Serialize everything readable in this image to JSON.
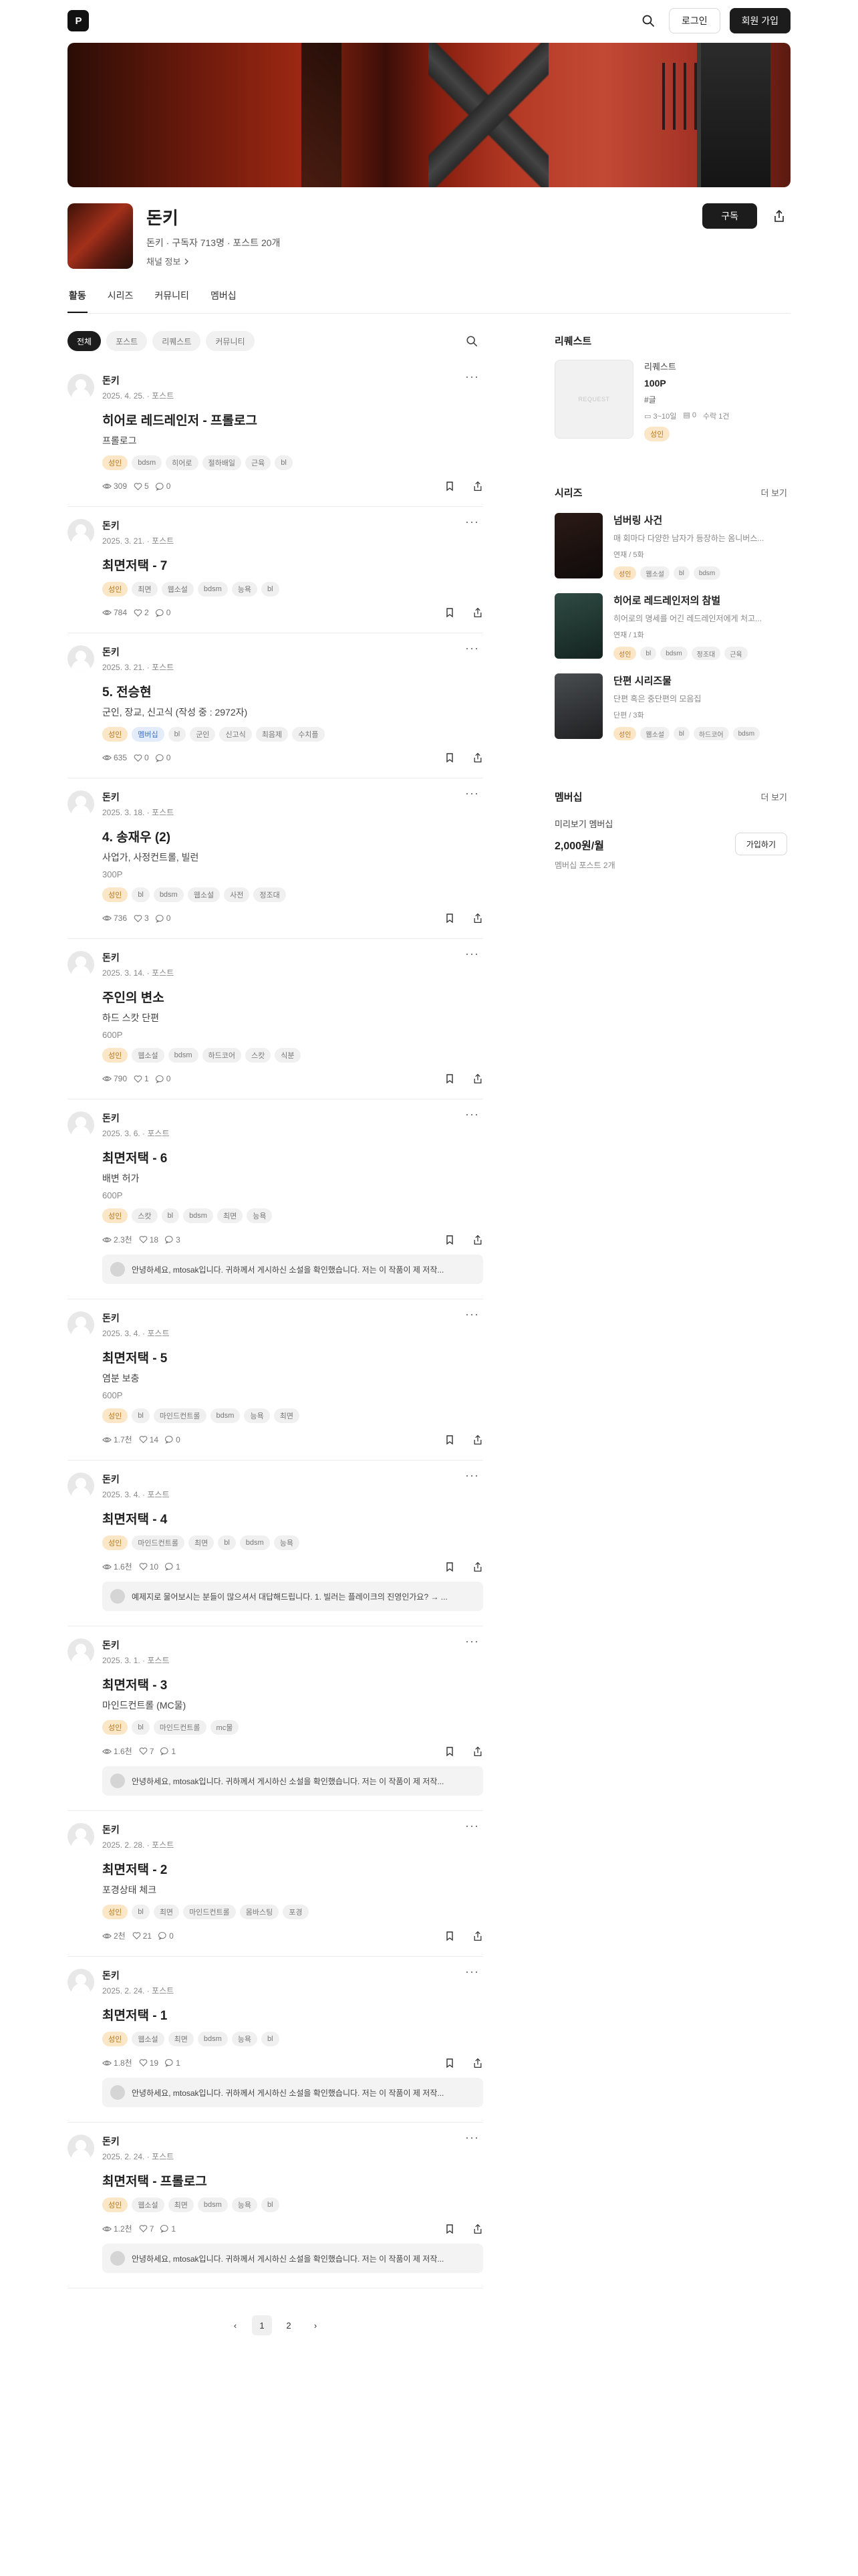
{
  "header": {
    "logo_text": "P",
    "login_label": "로그인",
    "signup_label": "회원 가입"
  },
  "profile": {
    "name": "돈키",
    "meta": "돈키 · 구독자 713명 · 포스트 20개",
    "channel_info": "채널 정보",
    "subscribe_label": "구독"
  },
  "tabs": [
    "활동",
    "시리즈",
    "커뮤니티",
    "멤버십"
  ],
  "filters": [
    "전체",
    "포스트",
    "리퀘스트",
    "커뮤니티"
  ],
  "posts": [
    {
      "author": "돈키",
      "date": "2025. 4. 25. · 포스트",
      "title": "히어로 레드레인저 - 프롤로그",
      "subtitle": "프롤로그",
      "price": "",
      "tags": [
        [
          "성인",
          "adult"
        ],
        [
          "bdsm",
          ""
        ],
        [
          "히어로",
          ""
        ],
        [
          "절하배일",
          ""
        ],
        [
          "근육",
          ""
        ],
        [
          "bl",
          ""
        ]
      ],
      "views": "309",
      "likes": "5",
      "comments": "0",
      "comment_text": ""
    },
    {
      "author": "돈키",
      "date": "2025. 3. 21. · 포스트",
      "title": "최면저택 - 7",
      "subtitle": "",
      "price": "",
      "tags": [
        [
          "성인",
          "adult"
        ],
        [
          "최면",
          ""
        ],
        [
          "웹소설",
          ""
        ],
        [
          "bdsm",
          ""
        ],
        [
          "능욕",
          ""
        ],
        [
          "bl",
          ""
        ]
      ],
      "views": "784",
      "likes": "2",
      "comments": "0",
      "comment_text": ""
    },
    {
      "author": "돈키",
      "date": "2025. 3. 21. · 포스트",
      "title": "5. 전승현",
      "subtitle": "군인, 장교, 신고식 (작성 중 : 2972자)",
      "price": "",
      "tags": [
        [
          "성인",
          "adult"
        ],
        [
          "멤버십",
          "member"
        ],
        [
          "bl",
          ""
        ],
        [
          "군인",
          ""
        ],
        [
          "신고식",
          ""
        ],
        [
          "최음제",
          ""
        ],
        [
          "수치플",
          ""
        ]
      ],
      "views": "635",
      "likes": "0",
      "comments": "0",
      "comment_text": ""
    },
    {
      "author": "돈키",
      "date": "2025. 3. 18. · 포스트",
      "title": "4. 송재우 (2)",
      "subtitle": "사업가, 사정컨트롤, 빌런",
      "price": "300P",
      "tags": [
        [
          "성인",
          "adult"
        ],
        [
          "bl",
          ""
        ],
        [
          "bdsm",
          ""
        ],
        [
          "웹소설",
          ""
        ],
        [
          "사전",
          ""
        ],
        [
          "정조대",
          ""
        ]
      ],
      "views": "736",
      "likes": "3",
      "comments": "0",
      "comment_text": ""
    },
    {
      "author": "돈키",
      "date": "2025. 3. 14. · 포스트",
      "title": "주인의 변소",
      "subtitle": "하드 스캇 단편",
      "price": "600P",
      "tags": [
        [
          "성인",
          "adult"
        ],
        [
          "웹소설",
          ""
        ],
        [
          "bdsm",
          ""
        ],
        [
          "하드코어",
          ""
        ],
        [
          "스캇",
          ""
        ],
        [
          "식분",
          ""
        ]
      ],
      "views": "790",
      "likes": "1",
      "comments": "0",
      "comment_text": ""
    },
    {
      "author": "돈키",
      "date": "2025. 3. 6. · 포스트",
      "title": "최면저택 - 6",
      "subtitle": "배변 허가",
      "price": "600P",
      "tags": [
        [
          "성인",
          "adult"
        ],
        [
          "스캇",
          ""
        ],
        [
          "bl",
          ""
        ],
        [
          "bdsm",
          ""
        ],
        [
          "최면",
          ""
        ],
        [
          "능욕",
          ""
        ]
      ],
      "views": "2.3천",
      "likes": "18",
      "comments": "3",
      "comment_text": "안녕하세요, mtosak입니다. 귀하께서 게시하신 소설을 확인했습니다. 저는 이 작품이 제 저작..."
    },
    {
      "author": "돈키",
      "date": "2025. 3. 4. · 포스트",
      "title": "최면저택 - 5",
      "subtitle": "염분 보충",
      "price": "600P",
      "tags": [
        [
          "성인",
          "adult"
        ],
        [
          "bl",
          ""
        ],
        [
          "마인드컨트롤",
          ""
        ],
        [
          "bdsm",
          ""
        ],
        [
          "능욕",
          ""
        ],
        [
          "최면",
          ""
        ]
      ],
      "views": "1.7천",
      "likes": "14",
      "comments": "0",
      "comment_text": ""
    },
    {
      "author": "돈키",
      "date": "2025. 3. 4. · 포스트",
      "title": "최면저택 - 4",
      "subtitle": "",
      "price": "",
      "tags": [
        [
          "성인",
          "adult"
        ],
        [
          "마인드컨트롤",
          ""
        ],
        [
          "최면",
          ""
        ],
        [
          "bl",
          ""
        ],
        [
          "bdsm",
          ""
        ],
        [
          "능욕",
          ""
        ]
      ],
      "views": "1.6천",
      "likes": "10",
      "comments": "1",
      "comment_text": "예제지로 물어보시는 분들이 많으셔서 대답해드립니다. 1. 빌러는 플레이크의 진영인가요? → ..."
    },
    {
      "author": "돈키",
      "date": "2025. 3. 1. · 포스트",
      "title": "최면저택 - 3",
      "subtitle": "마인드컨트롤 (MC물)",
      "price": "",
      "tags": [
        [
          "성인",
          "adult"
        ],
        [
          "bl",
          ""
        ],
        [
          "마인드컨트롤",
          ""
        ],
        [
          "mc물",
          ""
        ]
      ],
      "views": "1.6천",
      "likes": "7",
      "comments": "1",
      "comment_text": "안녕하세요, mtosak입니다. 귀하께서 게시하신 소설을 확인했습니다. 저는 이 작품이 제 저작..."
    },
    {
      "author": "돈키",
      "date": "2025. 2. 28. · 포스트",
      "title": "최면저택 - 2",
      "subtitle": "포경상태 체크",
      "price": "",
      "tags": [
        [
          "성인",
          "adult"
        ],
        [
          "bl",
          ""
        ],
        [
          "최면",
          ""
        ],
        [
          "마인드컨트롤",
          ""
        ],
        [
          "몸바스팅",
          ""
        ],
        [
          "포경",
          ""
        ]
      ],
      "views": "2천",
      "likes": "21",
      "comments": "0",
      "comment_text": ""
    },
    {
      "author": "돈키",
      "date": "2025. 2. 24. · 포스트",
      "title": "최면저택 - 1",
      "subtitle": "",
      "price": "",
      "tags": [
        [
          "성인",
          "adult"
        ],
        [
          "웹소설",
          ""
        ],
        [
          "최면",
          ""
        ],
        [
          "bdsm",
          ""
        ],
        [
          "능욕",
          ""
        ],
        [
          "bl",
          ""
        ]
      ],
      "views": "1.8천",
      "likes": "19",
      "comments": "1",
      "comment_text": "안녕하세요, mtosak입니다. 귀하께서 게시하신 소설을 확인했습니다. 저는 이 작품이 제 저작..."
    },
    {
      "author": "돈키",
      "date": "2025. 2. 24. · 포스트",
      "title": "최면저택 - 프롤로그",
      "subtitle": "",
      "price": "",
      "tags": [
        [
          "성인",
          "adult"
        ],
        [
          "웹소설",
          ""
        ],
        [
          "최면",
          ""
        ],
        [
          "bdsm",
          ""
        ],
        [
          "능욕",
          ""
        ],
        [
          "bl",
          ""
        ]
      ],
      "views": "1.2천",
      "likes": "7",
      "comments": "1",
      "comment_text": "안녕하세요, mtosak입니다. 귀하께서 게시하신 소설을 확인했습니다. 저는 이 작품이 제 저작..."
    }
  ],
  "pagination": {
    "pages": [
      "1",
      "2"
    ],
    "current": "1"
  },
  "sidebar": {
    "request": {
      "title": "리퀘스트",
      "thumb_text": "REQUEST",
      "label": "리퀘스트",
      "price": "100P",
      "tag": "#글",
      "period": "3~10일",
      "slots": "0",
      "accepted": "수락 1건",
      "badge": "성인"
    },
    "series": {
      "title": "시리즈",
      "more": "더 보기",
      "items": [
        {
          "title": "넘버링 사건",
          "desc": "매 회마다 다양한 남자가 등장하는 옴니버스...",
          "meta": "연재 / 5화",
          "tags": [
            [
              "성인",
              "adult"
            ],
            [
              "웹소설",
              ""
            ],
            [
              "bl",
              ""
            ],
            [
              "bdsm",
              ""
            ]
          ],
          "color1": "#2b1a16",
          "color2": "#0f0b0a"
        },
        {
          "title": "히어로 레드레인저의 참벌",
          "desc": "히어로의 명세를 어긴 레드레인저에게 처고...",
          "meta": "연재 / 1화",
          "tags": [
            [
              "성인",
              "adult"
            ],
            [
              "bl",
              ""
            ],
            [
              "bdsm",
              ""
            ],
            [
              "정조대",
              ""
            ],
            [
              "근육",
              ""
            ]
          ],
          "color1": "#2f4a44",
          "color2": "#142420"
        },
        {
          "title": "단편 시리즈물",
          "desc": "단편 혹은 중단편의 모음집",
          "meta": "단편 / 3화",
          "tags": [
            [
              "성인",
              "adult"
            ],
            [
              "웹소설",
              ""
            ],
            [
              "bl",
              ""
            ],
            [
              "하드코어",
              ""
            ],
            [
              "bdsm",
              ""
            ]
          ],
          "color1": "#4a4d50",
          "color2": "#1e2022"
        }
      ]
    },
    "membership": {
      "title": "멤버십",
      "more": "더 보기",
      "name": "미리보기 멤버십",
      "price": "2,000원/월",
      "note": "멤버십 포스트 2개",
      "join_label": "가입하기"
    }
  }
}
